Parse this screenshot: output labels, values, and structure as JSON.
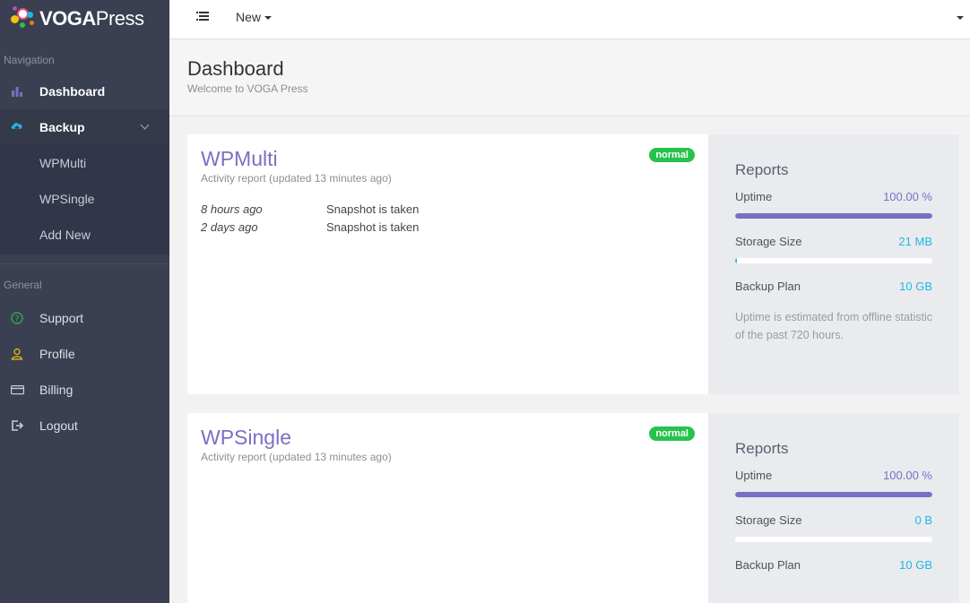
{
  "brand": {
    "name_bold": "VOGA",
    "name_rest": "Press"
  },
  "sidebar": {
    "nav_header": "Navigation",
    "general_header": "General",
    "items": [
      {
        "label": "Dashboard",
        "icon": "bar-chart-icon"
      },
      {
        "label": "Backup",
        "icon": "cloud-upload-icon"
      }
    ],
    "backup_subitems": [
      {
        "label": "WPMulti"
      },
      {
        "label": "WPSingle"
      },
      {
        "label": "Add New"
      }
    ],
    "general_items": [
      {
        "label": "Support",
        "icon": "question-circle-icon"
      },
      {
        "label": "Profile",
        "icon": "user-icon"
      },
      {
        "label": "Billing",
        "icon": "credit-card-icon"
      },
      {
        "label": "Logout",
        "icon": "logout-icon"
      }
    ]
  },
  "topbar": {
    "new_label": "New"
  },
  "page": {
    "title": "Dashboard",
    "subtitle": "Welcome to VOGA Press"
  },
  "colors": {
    "accent": "#7b6fc4",
    "info": "#23b7e5",
    "success": "#27c24c",
    "sidebar": "#3a3f51"
  },
  "sites": [
    {
      "name": "WPMulti",
      "status": "normal",
      "updated": "Activity report (updated 13 minutes ago)",
      "activity": [
        {
          "time": "8 hours ago",
          "text": "Snapshot is taken"
        },
        {
          "time": "2 days ago",
          "text": "Snapshot is taken"
        }
      ],
      "reports": {
        "title": "Reports",
        "uptime_label": "Uptime",
        "uptime_value": "100.00 %",
        "uptime_fraction": 1.0,
        "storage_label": "Storage Size",
        "storage_value": "21 MB",
        "storage_fraction": 0.002,
        "plan_label": "Backup Plan",
        "plan_value": "10 GB",
        "note": "Uptime is estimated from offline statistic of the past 720 hours."
      }
    },
    {
      "name": "WPSingle",
      "status": "normal",
      "updated": "Activity report (updated 13 minutes ago)",
      "activity": [],
      "reports": {
        "title": "Reports",
        "uptime_label": "Uptime",
        "uptime_value": "100.00 %",
        "uptime_fraction": 1.0,
        "storage_label": "Storage Size",
        "storage_value": "0 B",
        "storage_fraction": 0,
        "plan_label": "Backup Plan",
        "plan_value": "10 GB"
      }
    }
  ]
}
